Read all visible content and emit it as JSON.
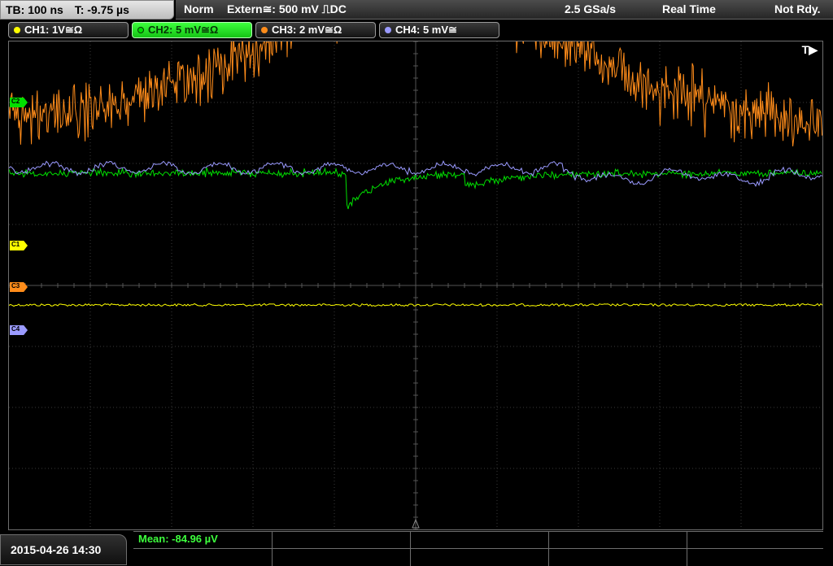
{
  "timebase": {
    "tb": "TB: 100 ns",
    "trigger_time": "T: -9.75 µs"
  },
  "status": {
    "mode": "Norm",
    "trigger_source": "Extern≅: 500 mV ⎍DC",
    "sample_rate": "2.5 GSa/s",
    "acq_mode": "Real Time",
    "state": "Not Rdy."
  },
  "channels": [
    {
      "label": "CH1: 1V≅Ω",
      "color": "#ffff00",
      "active": false,
      "marker": "C1",
      "ref_level": 0.46
    },
    {
      "label": "CH2: 5 mV≅Ω",
      "color": "#00e000",
      "active": true,
      "marker": "C2",
      "ref_level": 0.73
    },
    {
      "label": "CH3: 2 mV≅Ω",
      "color": "#ff8c1a",
      "active": false,
      "marker": "C3",
      "ref_level": 0.84
    },
    {
      "label": "CH4: 5 mV≅",
      "color": "#9a9aff",
      "active": false,
      "marker": "C4",
      "ref_level": 0.74
    }
  ],
  "trigger_marker": "T▶",
  "datetime": "2015-04-26 14:30",
  "measurement": {
    "mean": "Mean: -84.96 µV"
  }
}
